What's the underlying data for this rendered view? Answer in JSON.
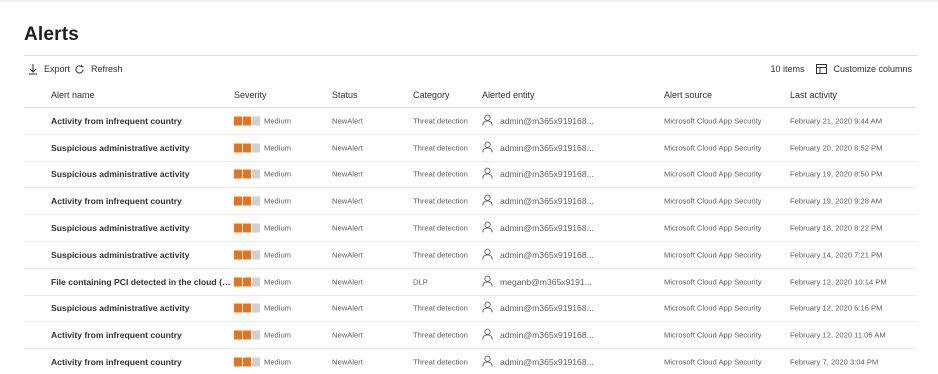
{
  "page": {
    "title": "Alerts"
  },
  "toolbar": {
    "export_label": "Export",
    "refresh_label": "Refresh",
    "items_count": "10 items",
    "customize_label": "Customize columns"
  },
  "colors": {
    "severity_filled": "#e8731e",
    "severity_empty": "#d2d0ce"
  },
  "columns": {
    "alert_name": "Alert name",
    "severity": "Severity",
    "status": "Status",
    "category": "Category",
    "alerted_entity": "Alerted entity",
    "alert_source": "Alert source",
    "last_activity": "Last activity"
  },
  "rows": [
    {
      "name": "Activity from infrequent country",
      "severity": "Medium",
      "status": "NewAlert",
      "category": "Threat detection",
      "entity": "admin@m365x919168...",
      "source": "Microsoft Cloud App Security",
      "last": "February 21, 2020 9:44 AM"
    },
    {
      "name": "Suspicious administrative activity",
      "severity": "Medium",
      "status": "NewAlert",
      "category": "Threat detection",
      "entity": "admin@m365x919168...",
      "source": "Microsoft Cloud App Security",
      "last": "February 20, 2020 8:52 PM"
    },
    {
      "name": "Suspicious administrative activity",
      "severity": "Medium",
      "status": "NewAlert",
      "category": "Threat detection",
      "entity": "admin@m365x919168...",
      "source": "Microsoft Cloud App Security",
      "last": "February 19, 2020 8:50 PM"
    },
    {
      "name": "Activity from infrequent country",
      "severity": "Medium",
      "status": "NewAlert",
      "category": "Threat detection",
      "entity": "admin@m365x919168...",
      "source": "Microsoft Cloud App Security",
      "last": "February 19, 2020 9:28 AM"
    },
    {
      "name": "Suspicious administrative activity",
      "severity": "Medium",
      "status": "NewAlert",
      "category": "Threat detection",
      "entity": "admin@m365x919168...",
      "source": "Microsoft Cloud App Security",
      "last": "February 18, 2020 8:22 PM"
    },
    {
      "name": "Suspicious administrative activity",
      "severity": "Medium",
      "status": "NewAlert",
      "category": "Threat detection",
      "entity": "admin@m365x919168...",
      "source": "Microsoft Cloud App Security",
      "last": "February 14, 2020 7:21 PM"
    },
    {
      "name": "File containing PCI detected in the cloud (built-i...",
      "severity": "Medium",
      "status": "NewAlert",
      "category": "DLP",
      "entity": "meganb@m365x9191...",
      "source": "Microsoft Cloud App Security",
      "last": "February 12, 2020 10:14 PM"
    },
    {
      "name": "Suspicious administrative activity",
      "severity": "Medium",
      "status": "NewAlert",
      "category": "Threat detection",
      "entity": "admin@m365x919168...",
      "source": "Microsoft Cloud App Security",
      "last": "February 12, 2020 6:16 PM"
    },
    {
      "name": "Activity from infrequent country",
      "severity": "Medium",
      "status": "NewAlert",
      "category": "Threat detection",
      "entity": "admin@m365x919168...",
      "source": "Microsoft Cloud App Security",
      "last": "February 12, 2020 11:06 AM"
    },
    {
      "name": "Activity from infrequent country",
      "severity": "Medium",
      "status": "NewAlert",
      "category": "Threat detection",
      "entity": "admin@m365x919168...",
      "source": "Microsoft Cloud App Security",
      "last": "February 7, 2020 3:04 PM"
    }
  ]
}
